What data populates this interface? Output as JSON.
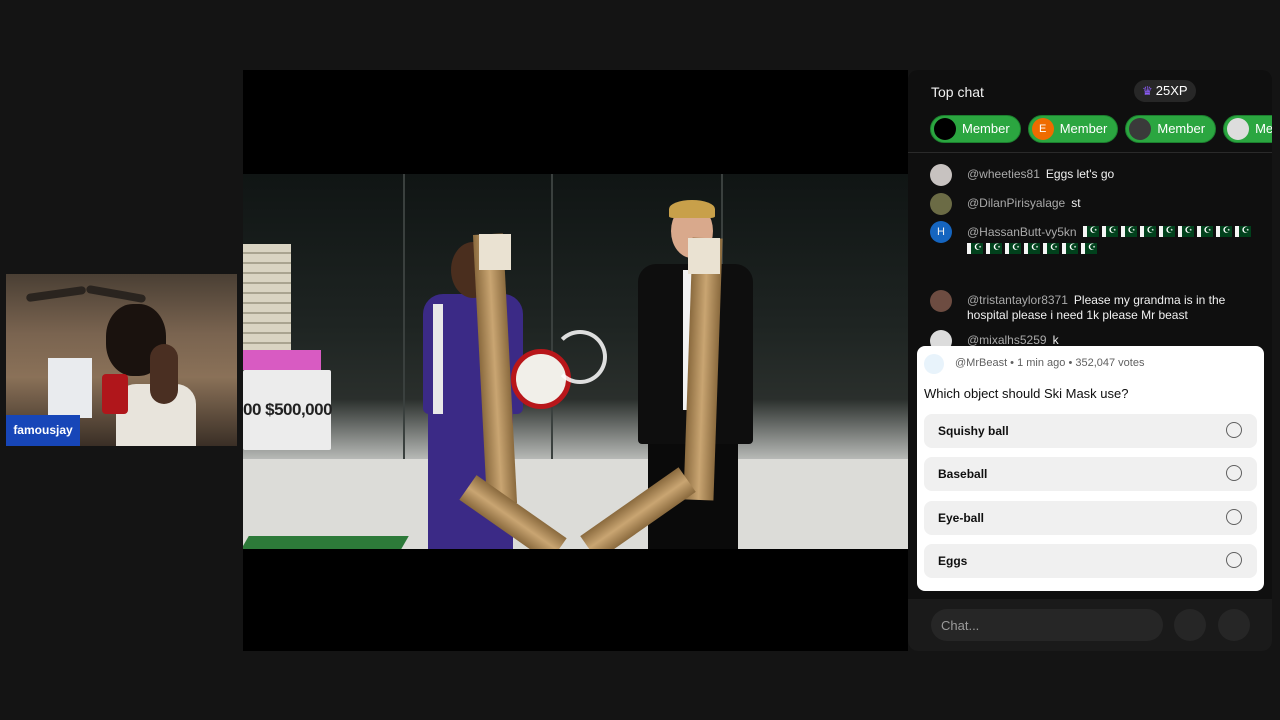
{
  "webcam": {
    "name": "famousjay"
  },
  "video": {
    "sign_text": "00 $500,000"
  },
  "chat": {
    "title": "Top chat",
    "xp_badge": "25XP",
    "members": [
      {
        "label": "Member",
        "avatar_color": "#000000",
        "avatar_letter": ""
      },
      {
        "label": "Member",
        "avatar_color": "#ef6c00",
        "avatar_letter": "E"
      },
      {
        "label": "Member",
        "avatar_color": "#3a3a3a",
        "avatar_letter": ""
      },
      {
        "label": "Mem",
        "avatar_color": "#dddddd",
        "avatar_letter": ""
      }
    ],
    "messages": [
      {
        "user": "@wheeties81",
        "text": "Eggs let's go",
        "avatar_color": "#c7c2c0"
      },
      {
        "user": "@DilanPirisyalage",
        "text": "st",
        "avatar_color": "#6b6b45"
      },
      {
        "user": "@HassanButt-vy5kn",
        "text": "",
        "avatar_color": "#1565c0",
        "avatar_letter": "H",
        "flag_count": 16
      },
      {
        "user": "@tristantaylor8371",
        "text": "Please my grandma is in the hospital please i need 1k please Mr beast",
        "avatar_color": "#6d4c41"
      },
      {
        "user": "@mixalhs5259",
        "text": "k",
        "avatar_color": "#dcdcdc"
      }
    ],
    "poll": {
      "meta": "@MrBeast • 1 min ago • 352,047 votes",
      "question": "Which object should Ski Mask use?",
      "options": [
        "Squishy ball",
        "Baseball",
        "Eye-ball",
        "Eggs"
      ]
    },
    "input_placeholder": "Chat..."
  },
  "colors": {
    "member_green": "#2ba640",
    "webcam_label": "#1746b8",
    "crown": "#8b5cf6"
  }
}
